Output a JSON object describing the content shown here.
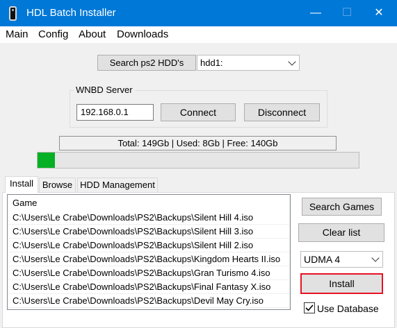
{
  "window": {
    "title": "HDL Batch Installer",
    "minimize": "—",
    "maximize": "☐",
    "close": "✕"
  },
  "menu": [
    "Main",
    "Config",
    "About",
    "Downloads"
  ],
  "search_hdd_button": "Search ps2 HDD's",
  "hdd_select": {
    "value": "hdd1:"
  },
  "wnbd": {
    "label": "WNBD Server",
    "ip": "192.168.0.1",
    "connect": "Connect",
    "disconnect": "Disconnect"
  },
  "storage": {
    "summary": "Total: 149Gb | Used: 8Gb | Free: 140Gb",
    "used_fraction": 0.054,
    "bar_color": "#06b025"
  },
  "tabs": [
    "Install",
    "Browse",
    "HDD Management"
  ],
  "games": {
    "header": "Game",
    "rows": [
      "C:\\Users\\Le Crabe\\Downloads\\PS2\\Backups\\Silent Hill 4.iso",
      "C:\\Users\\Le Crabe\\Downloads\\PS2\\Backups\\Silent Hill 3.iso",
      "C:\\Users\\Le Crabe\\Downloads\\PS2\\Backups\\Silent Hill 2.iso",
      "C:\\Users\\Le Crabe\\Downloads\\PS2\\Backups\\Kingdom Hearts II.iso",
      "C:\\Users\\Le Crabe\\Downloads\\PS2\\Backups\\Gran Turismo 4.iso",
      "C:\\Users\\Le Crabe\\Downloads\\PS2\\Backups\\Final Fantasy X.iso",
      "C:\\Users\\Le Crabe\\Downloads\\PS2\\Backups\\Devil May Cry.iso"
    ]
  },
  "actions": {
    "search_games": "Search Games",
    "clear_list": "Clear list",
    "udma": "UDMA 4",
    "install": "Install",
    "use_database": "Use Database",
    "use_database_checked": true,
    "highlight_color": "#e81123"
  }
}
